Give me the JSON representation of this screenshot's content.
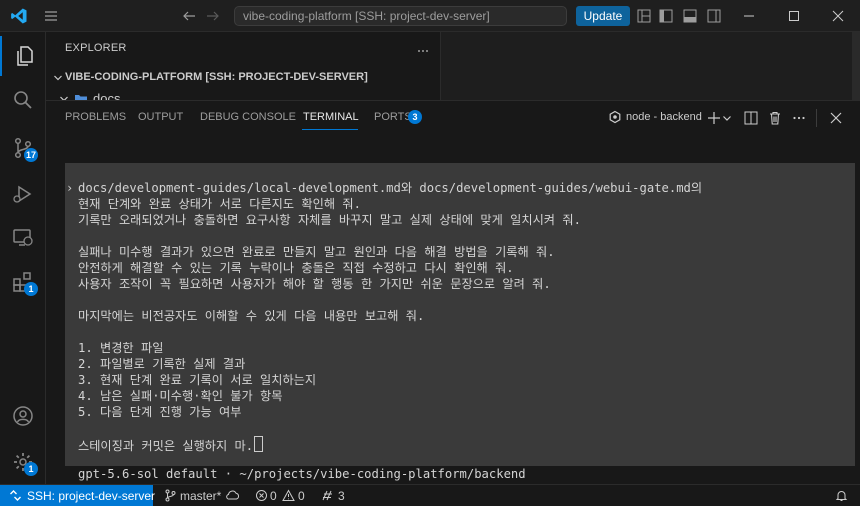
{
  "titlebar": {
    "command_center": "vibe-coding-platform [SSH: project-dev-server]",
    "update_label": "Update"
  },
  "activity": {
    "scm_badge": "17",
    "extensions_badge": "1",
    "settings_badge": "1"
  },
  "sidebar": {
    "title": "EXPLORER",
    "workspace": "VIBE-CODING-PLATFORM [SSH: PROJECT-DEV-SERVER]",
    "folder": "docs"
  },
  "panel": {
    "tabs": [
      "PROBLEMS",
      "OUTPUT",
      "DEBUG CONSOLE",
      "TERMINAL",
      "PORTS"
    ],
    "ports_badge": "3",
    "terminal_name": "node - backend"
  },
  "terminal": {
    "prompt": "›",
    "lines": [
      "docs/development-guides/local-development.md와 docs/development-guides/webui-gate.md의",
      "현재 단계와 완료 상태가 서로 다른지도 확인해 줘.",
      "기록만 오래되었거나 충돌하면 요구사항 자체를 바꾸지 말고 실제 상태에 맞게 일치시켜 줘.",
      "",
      "실패나 미수행 결과가 있으면 완료로 만들지 말고 원인과 다음 해결 방법을 기록해 줘.",
      "안전하게 해결할 수 있는 기록 누락이나 충돌은 직접 수정하고 다시 확인해 줘.",
      "사용자 조작이 꼭 필요하면 사용자가 해야 할 행동 한 가지만 쉬운 문장으로 알려 줘.",
      "",
      "마지막에는 비전공자도 이해할 수 있게 다음 내용만 보고해 줘.",
      "",
      "1. 변경한 파일",
      "2. 파일별로 기록한 실제 결과",
      "3. 현재 단계 완료 기록이 서로 일치하는지",
      "4. 남은 실패·미수행·확인 불가 항목",
      "5. 다음 단계 진행 가능 여부",
      "",
      "스테이징과 커밋은 실행하지 마."
    ],
    "status": "gpt-5.6-sol default · ~/projects/vibe-coding-platform/backend"
  },
  "statusbar": {
    "remote": "SSH: project-dev-server",
    "branch": "master*",
    "errors": "0",
    "warnings": "0",
    "ports": "3"
  },
  "colors": {
    "accent": "#0078d4",
    "update_button": "#0e639c",
    "terminal_bg": "#3a3a3a"
  }
}
